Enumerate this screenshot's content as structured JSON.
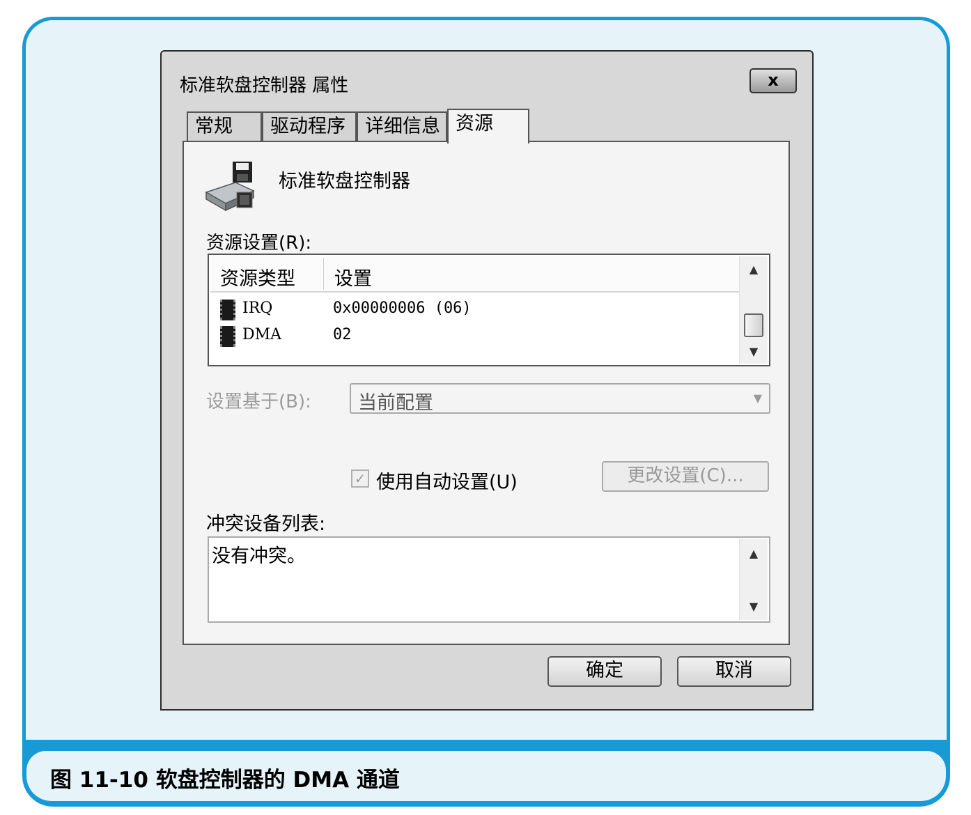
{
  "window": {
    "title": "标准软盘控制器 属性",
    "close_label": "x"
  },
  "tabs": [
    {
      "label": "常规"
    },
    {
      "label": "驱动程序"
    },
    {
      "label": "详细信息"
    },
    {
      "label": "资源",
      "active": true
    }
  ],
  "device": {
    "name": "标准软盘控制器",
    "icon": "floppy-controller-icon"
  },
  "resources": {
    "label": "资源设置(R):",
    "columns": [
      "资源类型",
      "设置"
    ],
    "rows": [
      {
        "type": "IRQ",
        "setting": "0x00000006  (06)",
        "icon": "chip-icon"
      },
      {
        "type": "DMA",
        "setting": "02",
        "icon": "chip-icon"
      }
    ]
  },
  "basis": {
    "label": "设置基于(B):",
    "value": "当前配置"
  },
  "auto": {
    "label": "使用自动设置(U)",
    "checked": true
  },
  "change_button": "更改设置(C)...",
  "conflicts": {
    "label": "冲突设备列表:",
    "text": "没有冲突。"
  },
  "buttons": {
    "ok": "确定",
    "cancel": "取消"
  },
  "caption": "图 11-10   软盘控制器的 DMA 通道",
  "colors": {
    "frame_accent": "#189ad6",
    "frame_background": "#e6f4fa"
  }
}
